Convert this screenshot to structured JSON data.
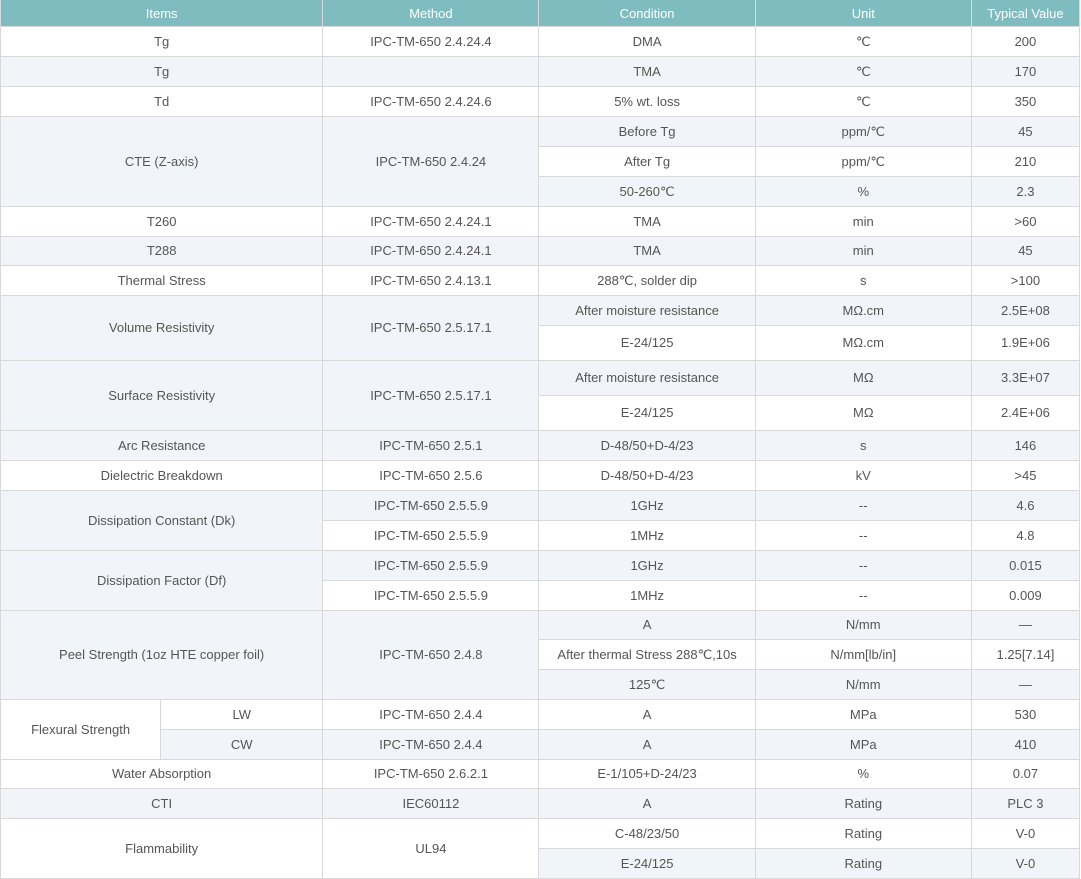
{
  "headers": {
    "items": "Items",
    "method": "Method",
    "condition": "Condition",
    "unit": "Unit",
    "value": "Typical Value"
  },
  "rows": {
    "tg_dma": {
      "item": "Tg",
      "method": "IPC-TM-650 2.4.24.4",
      "condition": "DMA",
      "unit": "℃",
      "value": "200"
    },
    "tg_tma": {
      "item": "Tg",
      "method": "",
      "condition": "TMA",
      "unit": "℃",
      "value": "170"
    },
    "td": {
      "item": "Td",
      "method": "IPC-TM-650 2.4.24.6",
      "condition": "5% wt. loss",
      "unit": "℃",
      "value": "350"
    },
    "cte": {
      "item": "CTE (Z-axis)",
      "method": "IPC-TM-650 2.4.24",
      "sub": [
        {
          "condition": "Before Tg",
          "unit": "ppm/℃",
          "value": "45"
        },
        {
          "condition": "After Tg",
          "unit": "ppm/℃",
          "value": "210"
        },
        {
          "condition": "50-260℃",
          "unit": "%",
          "value": "2.3"
        }
      ]
    },
    "t260": {
      "item": "T260",
      "method": "IPC-TM-650 2.4.24.1",
      "condition": "TMA",
      "unit": "min",
      "value": ">60"
    },
    "t288": {
      "item": "T288",
      "method": "IPC-TM-650 2.4.24.1",
      "condition": "TMA",
      "unit": "min",
      "value": "45"
    },
    "thermal_stress": {
      "item": "Thermal Stress",
      "method": "IPC-TM-650 2.4.13.1",
      "condition": "288℃, solder dip",
      "unit": "s",
      "value": ">100"
    },
    "volume_resistivity": {
      "item": "Volume Resistivity",
      "method": "IPC-TM-650 2.5.17.1",
      "sub": [
        {
          "condition": "After moisture resistance",
          "unit": "MΩ.cm",
          "value": "2.5E+08"
        },
        {
          "condition": "E-24/125",
          "unit": "MΩ.cm",
          "value": "1.9E+06"
        }
      ]
    },
    "surface_resistivity": {
      "item": "Surface Resistivity",
      "method": "IPC-TM-650 2.5.17.1",
      "sub": [
        {
          "condition": "After moisture resistance",
          "unit": "MΩ",
          "value": "3.3E+07"
        },
        {
          "condition": "E-24/125",
          "unit": "MΩ",
          "value": "2.4E+06"
        }
      ]
    },
    "arc_resistance": {
      "item": "Arc Resistance",
      "method": "IPC-TM-650 2.5.1",
      "condition": "D-48/50+D-4/23",
      "unit": "s",
      "value": "146"
    },
    "dielectric_breakdown": {
      "item": "Dielectric Breakdown",
      "method": "IPC-TM-650 2.5.6",
      "condition": "D-48/50+D-4/23",
      "unit": "kV",
      "value": ">45"
    },
    "dk": {
      "item": "Dissipation Constant (Dk)",
      "sub": [
        {
          "method": "IPC-TM-650 2.5.5.9",
          "condition": "1GHz",
          "unit": "--",
          "value": "4.6"
        },
        {
          "method": "IPC-TM-650 2.5.5.9",
          "condition": "1MHz",
          "unit": "--",
          "value": "4.8"
        }
      ]
    },
    "df": {
      "item": "Dissipation Factor (Df)",
      "sub": [
        {
          "method": "IPC-TM-650 2.5.5.9",
          "condition": "1GHz",
          "unit": "--",
          "value": "0.015"
        },
        {
          "method": "IPC-TM-650 2.5.5.9",
          "condition": "1MHz",
          "unit": "--",
          "value": "0.009"
        }
      ]
    },
    "peel": {
      "item": "Peel Strength (1oz HTE copper foil)",
      "method": "IPC-TM-650 2.4.8",
      "sub": [
        {
          "condition": "A",
          "unit": "N/mm",
          "value": "—"
        },
        {
          "condition": "After thermal Stress 288℃,10s",
          "unit": "N/mm[lb/in]",
          "value": "1.25[7.14]"
        },
        {
          "condition": "125℃",
          "unit": "N/mm",
          "value": "—"
        }
      ]
    },
    "flexural": {
      "item": "Flexural Strength",
      "sub": [
        {
          "direction": "LW",
          "method": "IPC-TM-650 2.4.4",
          "condition": "A",
          "unit": "MPa",
          "value": "530"
        },
        {
          "direction": "CW",
          "method": "IPC-TM-650 2.4.4",
          "condition": "A",
          "unit": "MPa",
          "value": "410"
        }
      ]
    },
    "water_absorption": {
      "item": "Water Absorption",
      "method": "IPC-TM-650 2.6.2.1",
      "condition": "E-1/105+D-24/23",
      "unit": "%",
      "value": "0.07"
    },
    "cti": {
      "item": "CTI",
      "method": "IEC60112",
      "condition": "A",
      "unit": "Rating",
      "value": "PLC 3"
    },
    "flammability": {
      "item": "Flammability",
      "method": "UL94",
      "sub": [
        {
          "condition": "C-48/23/50",
          "unit": "Rating",
          "value": "V-0"
        },
        {
          "condition": "E-24/125",
          "unit": "Rating",
          "value": "V-0"
        }
      ]
    }
  }
}
